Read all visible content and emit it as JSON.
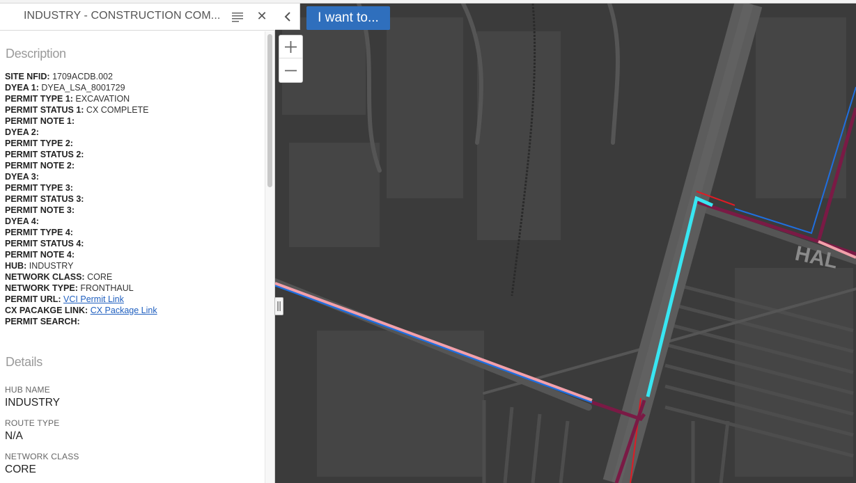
{
  "panel": {
    "title": "INDUSTRY - CONSTRUCTION COM...",
    "menu_icon": "list-icon",
    "close_icon": "close-icon",
    "close_glyph": "✕"
  },
  "description": {
    "heading": "Description",
    "attributes": [
      {
        "label": "SITE NFID:",
        "value": "1709ACDB.002"
      },
      {
        "label": "DYEA 1:",
        "value": "DYEA_LSA_8001729"
      },
      {
        "label": "PERMIT TYPE 1:",
        "value": "EXCAVATION"
      },
      {
        "label": "PERMIT STATUS 1:",
        "value": "CX COMPLETE"
      },
      {
        "label": "PERMIT NOTE 1:",
        "value": ""
      },
      {
        "label": "DYEA 2:",
        "value": ""
      },
      {
        "label": "PERMIT TYPE 2:",
        "value": ""
      },
      {
        "label": "PERMIT STATUS 2:",
        "value": ""
      },
      {
        "label": "PERMIT NOTE 2:",
        "value": ""
      },
      {
        "label": "DYEA 3:",
        "value": ""
      },
      {
        "label": "PERMIT TYPE 3:",
        "value": ""
      },
      {
        "label": "PERMIT STATUS 3:",
        "value": ""
      },
      {
        "label": "PERMIT NOTE 3:",
        "value": ""
      },
      {
        "label": "DYEA 4:",
        "value": ""
      },
      {
        "label": "PERMIT TYPE 4:",
        "value": ""
      },
      {
        "label": "PERMIT STATUS 4:",
        "value": ""
      },
      {
        "label": "PERMIT NOTE 4:",
        "value": ""
      },
      {
        "label": "HUB:",
        "value": "INDUSTRY"
      },
      {
        "label": "NETWORK CLASS:",
        "value": "CORE"
      },
      {
        "label": "NETWORK TYPE:",
        "value": "FRONTHAUL"
      },
      {
        "label": "PERMIT URL:",
        "link": "VCI Permit Link"
      },
      {
        "label": "CX PACAKGE LINK:",
        "link": "CX Package Link"
      },
      {
        "label": "PERMIT SEARCH:",
        "value": ""
      }
    ]
  },
  "details": {
    "heading": "Details",
    "fields": [
      {
        "label": "HUB NAME",
        "value": "INDUSTRY"
      },
      {
        "label": "ROUTE TYPE",
        "value": "N/A"
      },
      {
        "label": "NETWORK CLASS",
        "value": "CORE"
      }
    ]
  },
  "map": {
    "i_want_to": "I want to...",
    "street_label": "HAL",
    "colors": {
      "background": "#3b3b3b",
      "road": "#5a5a5a",
      "block": "#474747",
      "route_blue": "#1f6fe0",
      "route_pink": "#f2a0aa",
      "route_maroon": "#7a1a45",
      "route_red": "#e01b24",
      "route_cyan": "#38e6f2",
      "button_blue": "#2f6fbd"
    },
    "icons": [
      "chevron-left-icon",
      "plus-icon",
      "minus-icon",
      "resize-handle-icon"
    ]
  }
}
